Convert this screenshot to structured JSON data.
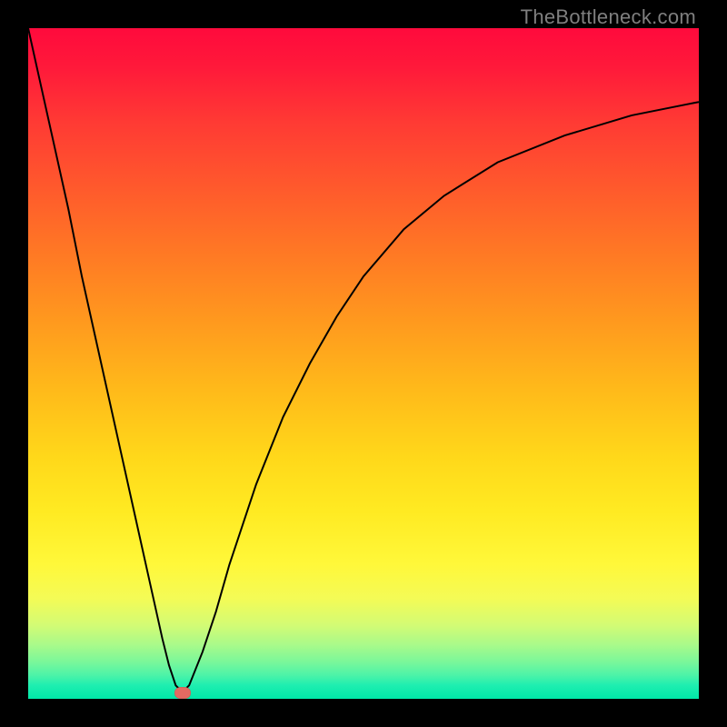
{
  "watermark": "TheBottleneck.com",
  "colors": {
    "frame": "#000000",
    "curve": "#000000",
    "marker": "#e36a62"
  },
  "chart_data": {
    "type": "line",
    "title": "",
    "xlabel": "",
    "ylabel": "",
    "xlim": [
      0,
      100
    ],
    "ylim": [
      0,
      100
    ],
    "series": [
      {
        "name": "bottleneck-curve",
        "x": [
          0,
          2,
          4,
          6,
          8,
          10,
          12,
          14,
          16,
          18,
          20,
          21,
          22,
          23,
          24,
          26,
          28,
          30,
          34,
          38,
          42,
          46,
          50,
          56,
          62,
          70,
          80,
          90,
          100
        ],
        "values": [
          100,
          91,
          82,
          73,
          63,
          54,
          45,
          36,
          27,
          18,
          9,
          5,
          2,
          1,
          2,
          7,
          13,
          20,
          32,
          42,
          50,
          57,
          63,
          70,
          75,
          80,
          84,
          87,
          89
        ]
      }
    ],
    "markers": [
      {
        "name": "min-point",
        "x": 23,
        "y": 1
      }
    ],
    "grid": false,
    "legend": false,
    "background_gradient": {
      "direction": "vertical",
      "stops": [
        {
          "pos": 0.0,
          "color": "#ff0a3c"
        },
        {
          "pos": 0.5,
          "color": "#ffba1a"
        },
        {
          "pos": 0.8,
          "color": "#fff83a"
        },
        {
          "pos": 1.0,
          "color": "#00e8a8"
        }
      ]
    }
  }
}
